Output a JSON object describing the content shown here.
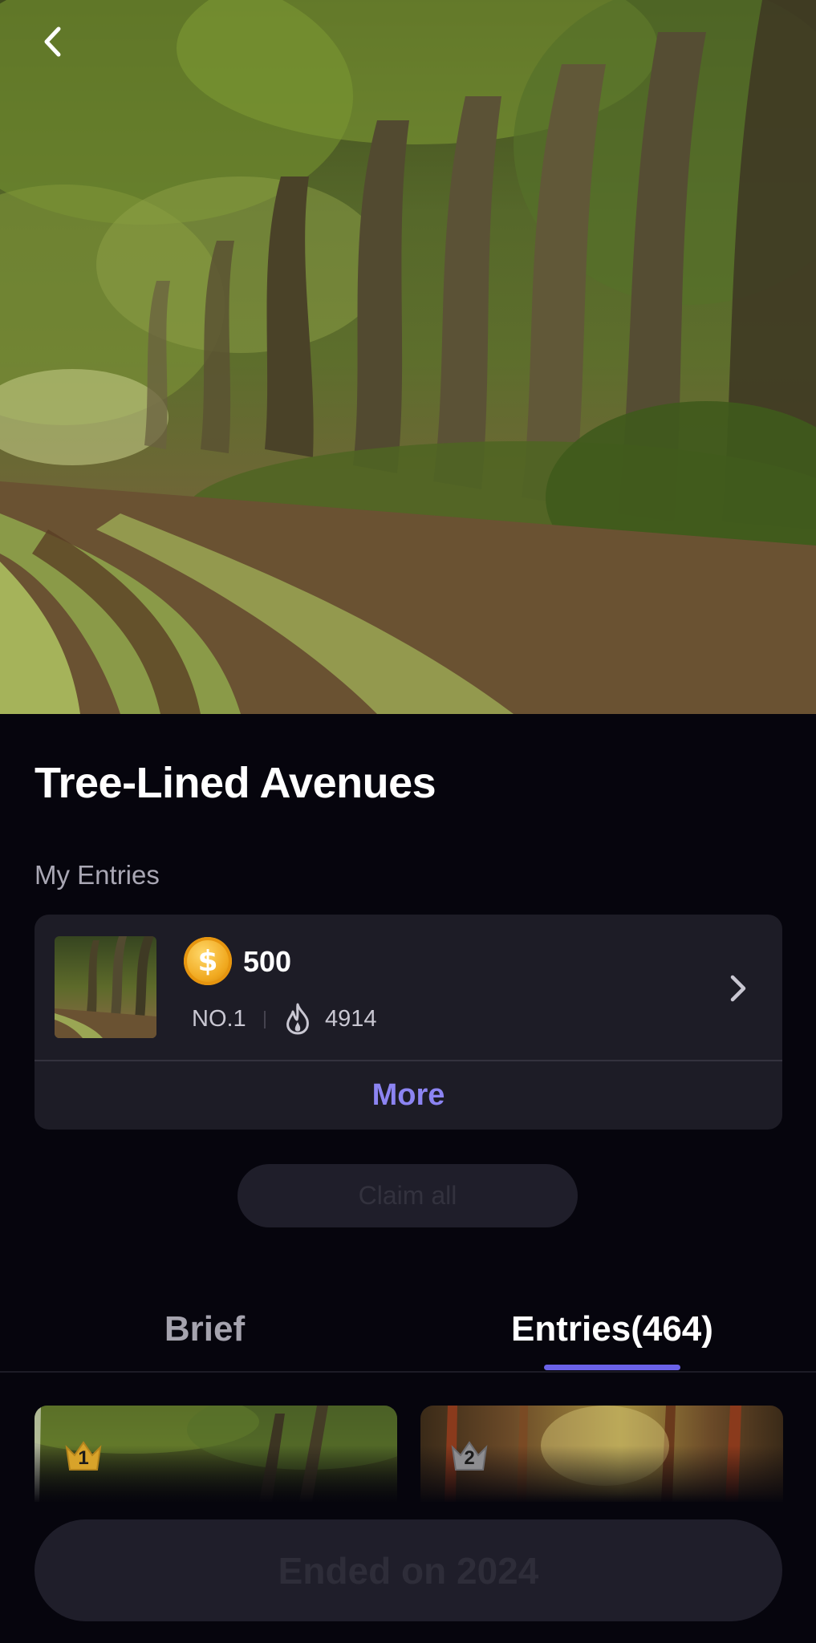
{
  "hero": {
    "image_description": "tree-lined forest path",
    "back_icon": "chevron-left-icon"
  },
  "title": "Tree-Lined Avenues",
  "my_entries": {
    "label": "My Entries",
    "entry": {
      "reward_icon": "coin-icon",
      "coin_symbol": "$",
      "reward": "500",
      "rank": "NO.1",
      "heat_icon": "fire-icon",
      "heat": "4914",
      "arrow_icon": "chevron-right-icon"
    },
    "more_label": "More"
  },
  "claim_all_label": "Claim all",
  "tabs": [
    {
      "label": "Brief",
      "active": false
    },
    {
      "label": "Entries(464)",
      "active": true
    }
  ],
  "entries_grid": [
    {
      "rank": "1",
      "badge_icon": "gold-crown-icon"
    },
    {
      "rank": "2",
      "badge_icon": "silver-crown-icon"
    }
  ],
  "footer_button_label": "Ended on 2024",
  "colors": {
    "background": "#06050d",
    "card": "#1d1c26",
    "accent": "#6a62e8",
    "link": "#8c84f2",
    "coin": "#f0a81e"
  }
}
